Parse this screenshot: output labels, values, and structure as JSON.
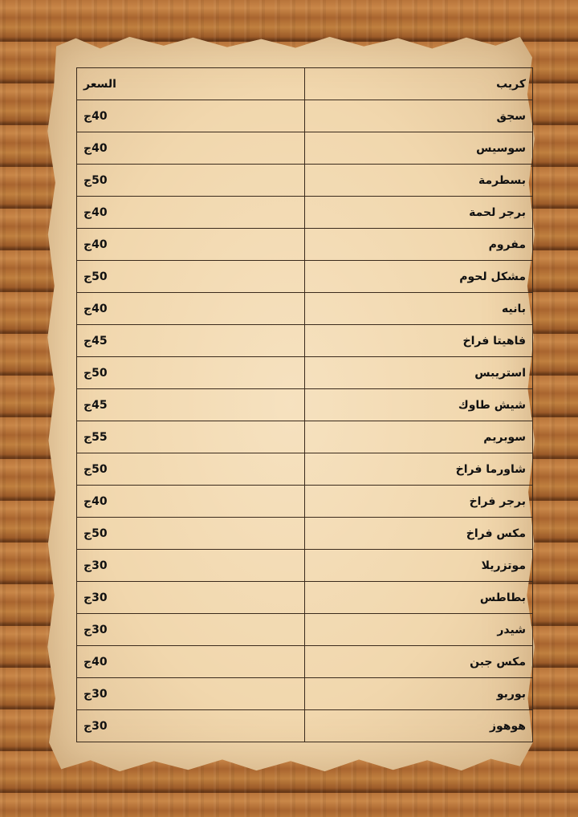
{
  "menu": {
    "header": {
      "item": "كريب",
      "price": "السعر"
    },
    "rows": [
      {
        "item": "سجق",
        "price": "40ج"
      },
      {
        "item": "سوسيس",
        "price": "40ج"
      },
      {
        "item": "بسطرمة",
        "price": "50ج"
      },
      {
        "item": "برجر لحمة",
        "price": "40ج"
      },
      {
        "item": "مفروم",
        "price": "40ج"
      },
      {
        "item": "مشكل لحوم",
        "price": "50ج"
      },
      {
        "item": "بانيه",
        "price": "40ج"
      },
      {
        "item": "فاهيتا فراخ",
        "price": "45ج"
      },
      {
        "item": "استريبس",
        "price": "50ج"
      },
      {
        "item": "شيش طاوك",
        "price": "45ج"
      },
      {
        "item": "سوبريم",
        "price": "55ج"
      },
      {
        "item": "شاورما فراخ",
        "price": "50ج"
      },
      {
        "item": "برجر فراخ",
        "price": "40ج"
      },
      {
        "item": "مكس فراخ",
        "price": "50ج"
      },
      {
        "item": "موتزريلا",
        "price": "30ج"
      },
      {
        "item": "بطاطس",
        "price": "30ج"
      },
      {
        "item": "شيدر",
        "price": "30ج"
      },
      {
        "item": "مكس جبن",
        "price": "40ج"
      },
      {
        "item": "بوريو",
        "price": "30ج"
      },
      {
        "item": "هوهوز",
        "price": "30ج"
      }
    ]
  },
  "colors": {
    "paper": "#f1d7ad",
    "wood": "#b8743a",
    "border": "#3a2a1c"
  }
}
